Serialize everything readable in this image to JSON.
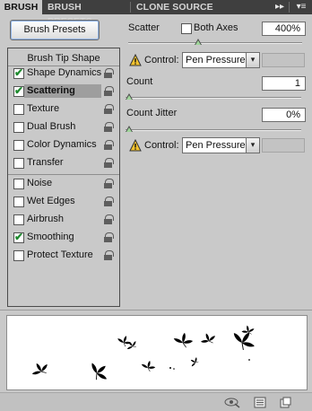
{
  "tabs": [
    "BRUSH",
    "BRUSH PRESETS",
    "CLONE SOURCE"
  ],
  "tab_buttons": {
    "forward": "▸▸",
    "menu": "▾≡"
  },
  "presets_button": "Brush Presets",
  "options": {
    "header": "Brush Tip Shape",
    "items": [
      {
        "label": "Shape Dynamics",
        "checked": true
      },
      {
        "label": "Scattering",
        "checked": true,
        "selected": true
      },
      {
        "label": "Texture",
        "checked": false
      },
      {
        "label": "Dual Brush",
        "checked": false
      },
      {
        "label": "Color Dynamics",
        "checked": false
      },
      {
        "label": "Transfer",
        "checked": false
      },
      {
        "label": "Noise",
        "checked": false
      },
      {
        "label": "Wet Edges",
        "checked": false
      },
      {
        "label": "Airbrush",
        "checked": false
      },
      {
        "label": "Smoothing",
        "checked": true
      },
      {
        "label": "Protect Texture",
        "checked": false
      }
    ],
    "check_mark": "✔"
  },
  "scatter": {
    "label": "Scatter",
    "both_axes_label": "Both Axes",
    "both_axes": false,
    "value": "400%",
    "slider_fraction": 0.4
  },
  "control1": {
    "label": "Control:",
    "value": "Pen Pressure"
  },
  "count": {
    "label": "Count",
    "value": "1",
    "slider_fraction": 0.0
  },
  "count_jitter": {
    "label": "Count Jitter",
    "value": "0%",
    "slider_fraction": 0.0
  },
  "control2": {
    "label": "Control:",
    "value": "Pen Pressure"
  },
  "dropdown_arrow": "▾",
  "colors": {
    "tab_bar": "#3f3f3f",
    "panel": "#c9c9c9",
    "selected_row": "#9e9e9e",
    "check": "#1e8a2e",
    "warning": "#f2c22e"
  }
}
